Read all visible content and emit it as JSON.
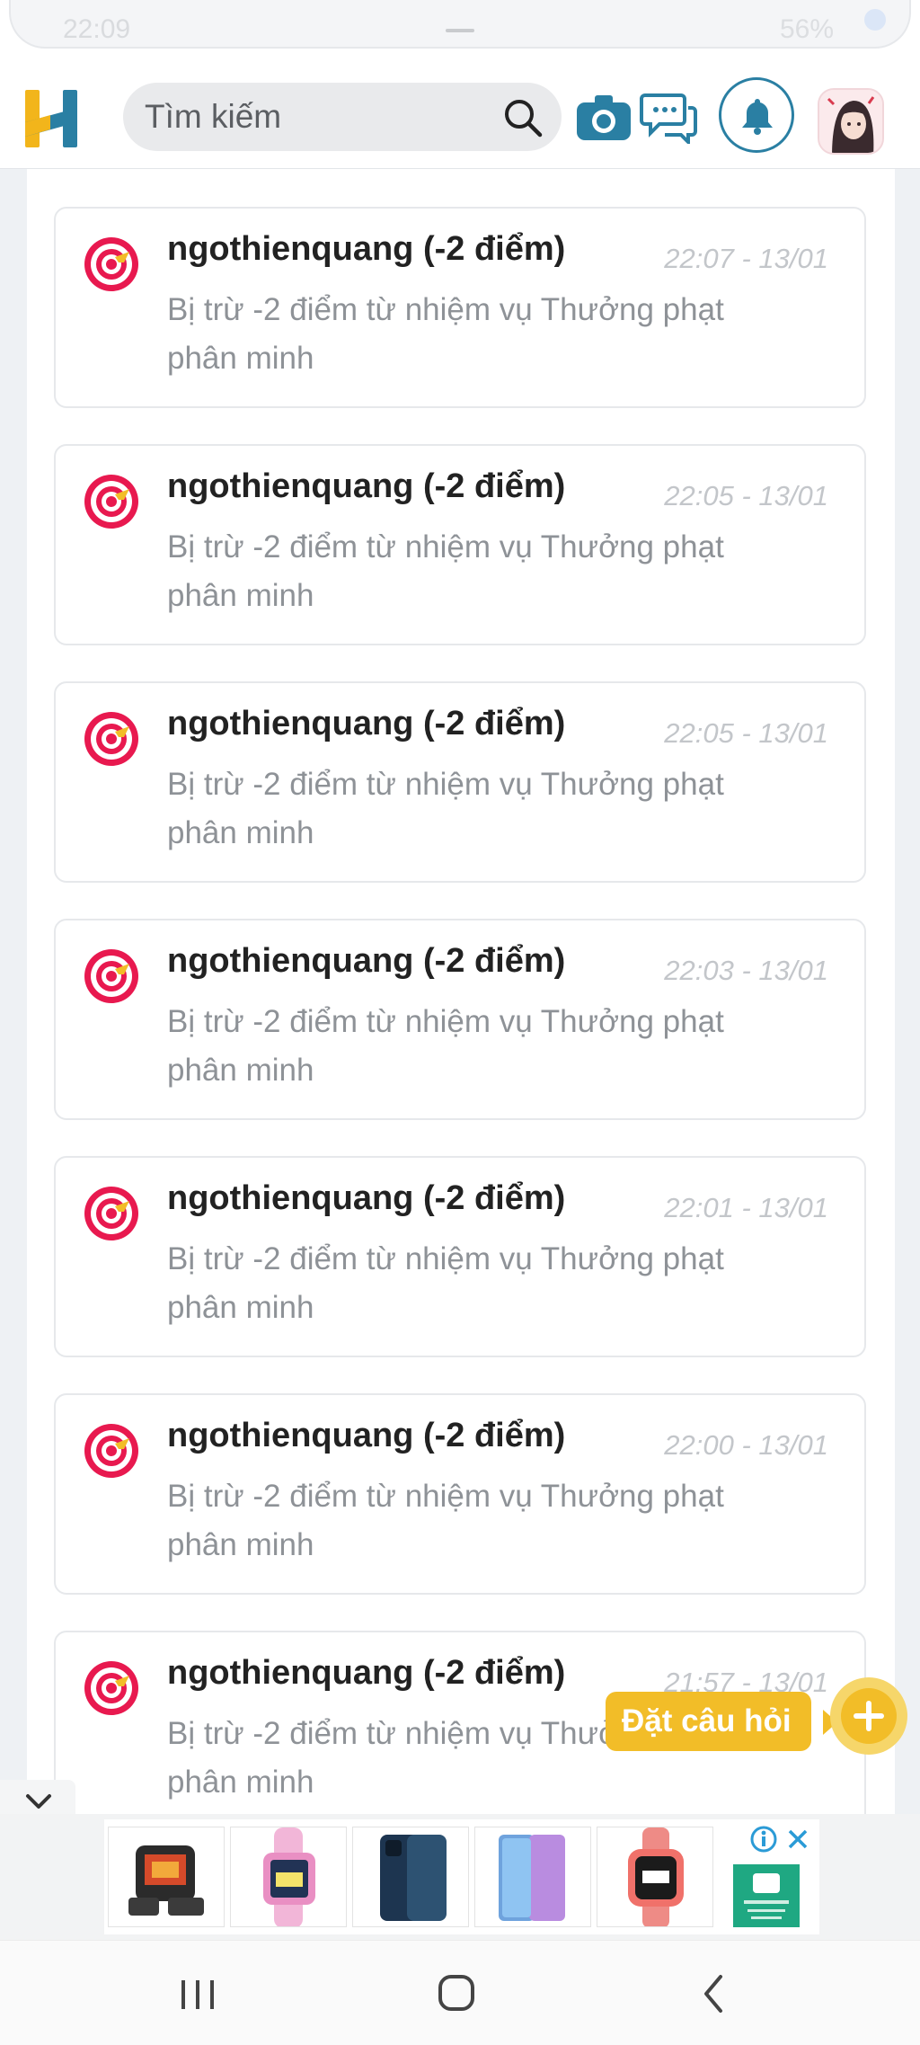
{
  "status_bar": {
    "time": "22:09",
    "battery": "56%"
  },
  "header": {
    "logo": "H",
    "search_placeholder": "Tìm kiếm",
    "icons": [
      "search-icon",
      "camera-icon",
      "chat-icon",
      "bell-icon"
    ]
  },
  "notifications": [
    {
      "title": "ngothienquang (-2 điểm)",
      "time": "22:07 - 13/01",
      "message": "Bị trừ -2 điểm từ nhiệm vụ Thưởng phạt phân minh"
    },
    {
      "title": "ngothienquang (-2 điểm)",
      "time": "22:05 - 13/01",
      "message": "Bị trừ -2 điểm từ nhiệm vụ Thưởng phạt phân minh"
    },
    {
      "title": "ngothienquang (-2 điểm)",
      "time": "22:05 - 13/01",
      "message": "Bị trừ -2 điểm từ nhiệm vụ Thưởng phạt phân minh"
    },
    {
      "title": "ngothienquang (-2 điểm)",
      "time": "22:03 - 13/01",
      "message": "Bị trừ -2 điểm từ nhiệm vụ Thưởng phạt phân minh"
    },
    {
      "title": "ngothienquang (-2 điểm)",
      "time": "22:01 - 13/01",
      "message": "Bị trừ -2 điểm từ nhiệm vụ Thưởng phạt phân minh"
    },
    {
      "title": "ngothienquang (-2 điểm)",
      "time": "22:00 - 13/01",
      "message": "Bị trừ -2 điểm từ nhiệm vụ Thưởng phạt phân minh"
    },
    {
      "title": "ngothienquang (-2 điểm)",
      "time": "21:57 - 13/01",
      "message": "Bị trừ -2 điểm từ nhiệm vụ Thưởng phạt phân minh"
    }
  ],
  "ask_button": {
    "label": "Đặt câu hỏi"
  },
  "colors": {
    "accent": "#f2bd28",
    "brand_blue": "#2a7fa3",
    "notification_icon": "#e8194f"
  }
}
